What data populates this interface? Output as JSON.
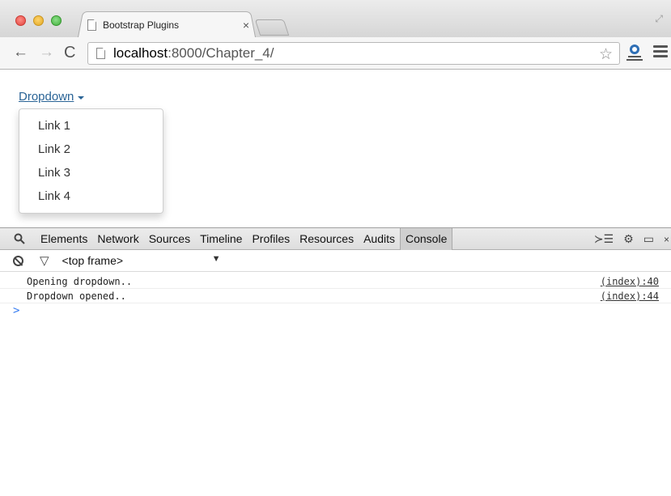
{
  "browser": {
    "tab": {
      "title": "Bootstrap Plugins",
      "close": "×"
    },
    "nav": {
      "back": "←",
      "forward": "→",
      "reload": "C"
    },
    "address": {
      "host": "localhost",
      "port_path": ":8000/Chapter_4/"
    },
    "icons": {
      "star": "☆"
    }
  },
  "page": {
    "dropdown": {
      "toggle_label": "Dropdown",
      "items": [
        "Link 1",
        "Link 2",
        "Link 3",
        "Link 4"
      ]
    }
  },
  "devtools": {
    "search_glyph": "🔍",
    "tabs": [
      "Elements",
      "Network",
      "Sources",
      "Timeline",
      "Profiles",
      "Resources",
      "Audits",
      "Console"
    ],
    "active_tab": "Console",
    "right_icons": {
      "drawer": "≻☰",
      "settings": "⚙",
      "dock": "▭",
      "close": "×"
    },
    "filter": {
      "frame": "<top frame>",
      "arrow": "▼",
      "filter_glyph": "▽"
    },
    "messages": [
      {
        "text": "Opening dropdown..",
        "source": "(index):40"
      },
      {
        "text": "Dropdown opened..",
        "source": "(index):44"
      }
    ],
    "prompt": ">"
  }
}
